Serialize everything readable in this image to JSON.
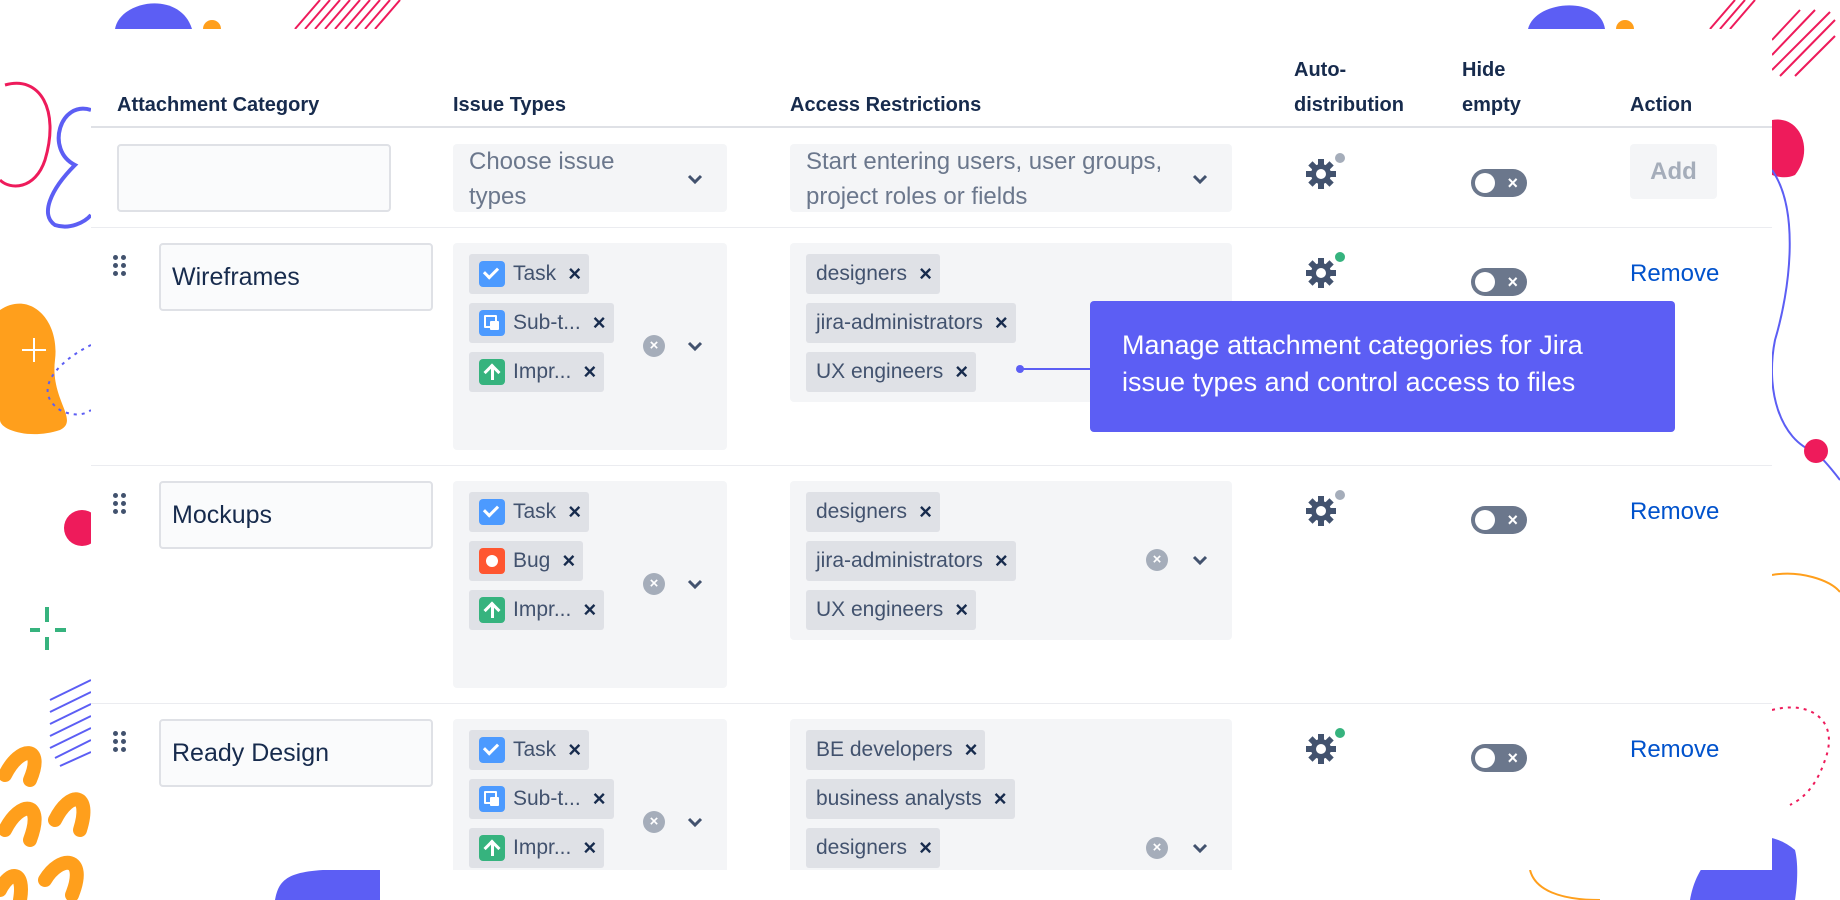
{
  "table": {
    "headers": {
      "category": "Attachment Category",
      "issue_types": "Issue Types",
      "access": "Access Restrictions",
      "auto_line1": "Auto-",
      "auto_line2": "distribution",
      "hide_line1": "Hide",
      "hide_line2": "empty",
      "action": "Action"
    },
    "new_row": {
      "category_value": "",
      "issue_types_placeholder": "Choose issue types",
      "access_placeholder": "Start entering users, user groups, project roles or fields",
      "add_label": "Add",
      "auto_distribution": "off",
      "hide_empty": "off",
      "toggle_glyph": "×"
    },
    "rows": [
      {
        "category": "Wireframes",
        "issue_types": [
          "Task",
          "Sub-t...",
          "Impr..."
        ],
        "access": [
          "designers",
          "jira-administrators",
          "UX engineers"
        ],
        "auto_distribution": "on",
        "hide_empty": "off",
        "action": "Remove"
      },
      {
        "category": "Mockups",
        "issue_types": [
          "Task",
          "Bug",
          "Impr..."
        ],
        "access": [
          "designers",
          "jira-administrators",
          "UX engineers"
        ],
        "auto_distribution": "off",
        "hide_empty": "off",
        "action": "Remove"
      },
      {
        "category": "Ready Design",
        "issue_types": [
          "Task",
          "Sub-t...",
          "Impr..."
        ],
        "access": [
          "BE developers",
          "business analysts",
          "designers"
        ],
        "auto_distribution": "on",
        "hide_empty": "off",
        "action": "Remove"
      }
    ],
    "chip_remove_glyph": "×",
    "clear_glyph": "×"
  },
  "tooltip": {
    "line1": "Manage attachment categories for Jira",
    "line2": "issue types and control access to files"
  },
  "icons": {
    "task": "task-icon",
    "subtask": "subtask-icon",
    "improvement": "improvement-icon",
    "bug": "bug-icon",
    "gear": "gear-icon",
    "drag": "drag-handle-icon",
    "chevron": "chevron-down-icon",
    "clear": "clear-icon"
  },
  "colors": {
    "accent": "#5c5ef4",
    "link": "#0052cc",
    "status_on": "#36b37e",
    "status_off": "#a5adba",
    "deco_orange": "#ff9f1c",
    "deco_pink": "#ee1b5b",
    "deco_blue": "#5c5ef4"
  }
}
